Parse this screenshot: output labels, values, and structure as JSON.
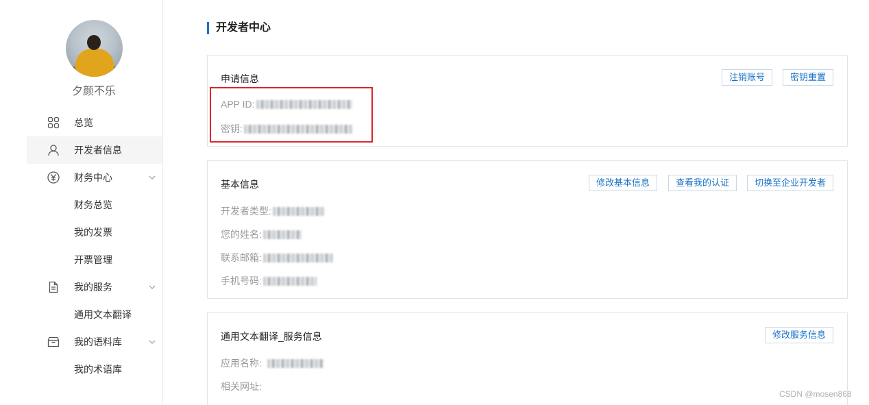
{
  "user": {
    "name": "夕颜不乐"
  },
  "nav": {
    "items": [
      {
        "label": "总览"
      },
      {
        "label": "开发者信息"
      },
      {
        "label": "财务中心"
      },
      {
        "label": "财务总览"
      },
      {
        "label": "我的发票"
      },
      {
        "label": "开票管理"
      },
      {
        "label": "我的服务"
      },
      {
        "label": "通用文本翻译"
      },
      {
        "label": "我的语料库"
      },
      {
        "label": "我的术语库"
      }
    ],
    "active": "开发者信息"
  },
  "page": {
    "title": "开发者中心"
  },
  "apply_info": {
    "title": "申请信息",
    "buttons": [
      "注销账号",
      "密钥重置"
    ],
    "fields": [
      {
        "label": "APP ID:"
      },
      {
        "label": "密钥:"
      }
    ]
  },
  "basic_info": {
    "title": "基本信息",
    "buttons": [
      "修改基本信息",
      "查看我的认证",
      "切换至企业开发者"
    ],
    "fields": [
      {
        "label": "开发者类型:"
      },
      {
        "label": "您的姓名:"
      },
      {
        "label": "联系邮箱:"
      },
      {
        "label": "手机号码:"
      }
    ]
  },
  "service_info": {
    "title": "通用文本翻译_服务信息",
    "buttons": [
      "修改服务信息"
    ],
    "fields": [
      {
        "label": "应用名称:"
      },
      {
        "label": "相关网址:"
      }
    ]
  },
  "watermark": "CSDN @mosen868",
  "colors": {
    "accent": "#1a73c9",
    "highlight": "#d9262c"
  }
}
